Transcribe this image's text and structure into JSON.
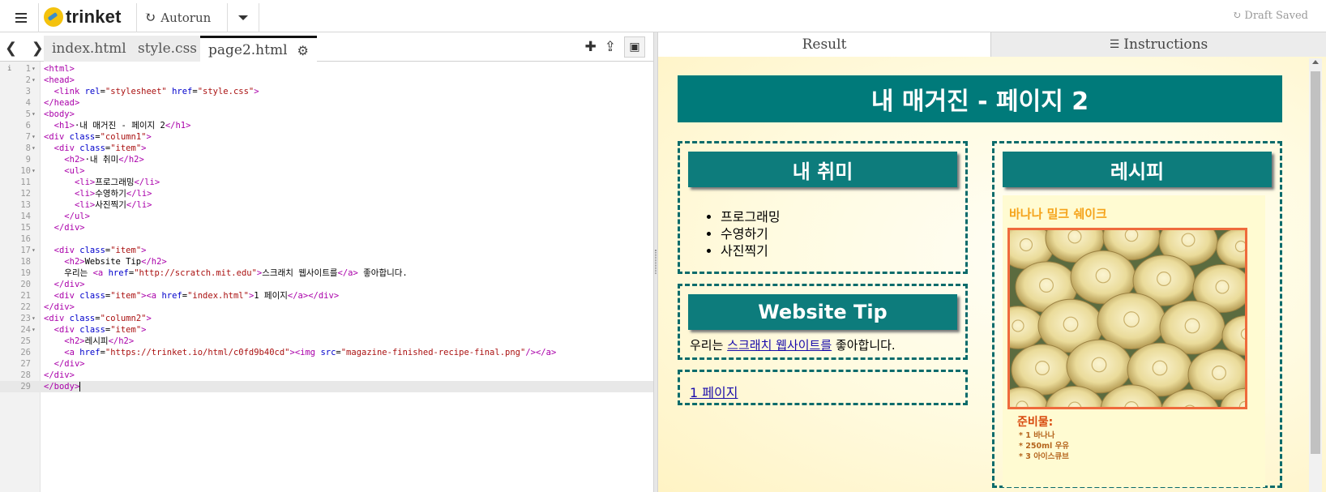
{
  "topbar": {
    "logo_text": "trinket",
    "autorun_label": "Autorun",
    "draft_status": "Draft Saved"
  },
  "editor": {
    "nav_arrows": "❮ ❯",
    "tabs": [
      {
        "label": "index.html"
      },
      {
        "label": "style.css"
      },
      {
        "label": "page2.html"
      }
    ],
    "active_tab": "page2.html"
  },
  "code_lines": [
    {
      "n": "1",
      "text": "<html>"
    },
    {
      "n": "2",
      "text": "<head>"
    },
    {
      "n": "3",
      "text": "  <link rel=\"stylesheet\" href=\"style.css\">"
    },
    {
      "n": "4",
      "text": "</head>"
    },
    {
      "n": "5",
      "text": "<body>"
    },
    {
      "n": "6",
      "text": "  <h1>·내 매거진 - 페이지 2</h1>"
    },
    {
      "n": "7",
      "text": "<div class=\"column1\">"
    },
    {
      "n": "8",
      "text": "  <div class=\"item\">"
    },
    {
      "n": "9",
      "text": "    <h2>·내 취미</h2>"
    },
    {
      "n": "10",
      "text": "    <ul>"
    },
    {
      "n": "11",
      "text": "      <li>프로그래밍</li>"
    },
    {
      "n": "12",
      "text": "      <li>수영하기</li>"
    },
    {
      "n": "13",
      "text": "      <li>사진찍기</li>"
    },
    {
      "n": "14",
      "text": "    </ul>"
    },
    {
      "n": "15",
      "text": "  </div>"
    },
    {
      "n": "16",
      "text": ""
    },
    {
      "n": "17",
      "text": "  <div class=\"item\">"
    },
    {
      "n": "18",
      "text": "    <h2>Website Tip</h2>"
    },
    {
      "n": "19",
      "text": "    우리는 <a href=\"http://scratch.mit.edu\">스크래치 웹사이트를</a> 좋아합니다."
    },
    {
      "n": "20",
      "text": "  </div>"
    },
    {
      "n": "21",
      "text": "  <div class=\"item\"><a href=\"index.html\">1 페이지</a></div>"
    },
    {
      "n": "22",
      "text": "</div>"
    },
    {
      "n": "23",
      "text": "<div class=\"column2\">"
    },
    {
      "n": "24",
      "text": "  <div class=\"item\">"
    },
    {
      "n": "25",
      "text": "    <h2>레시피</h2>"
    },
    {
      "n": "26",
      "text": "    <a href=\"https://trinket.io/html/c0fd9b40cd\"><img src=\"magazine-finished-recipe-final.png\"/></a>"
    },
    {
      "n": "27",
      "text": "  </div>"
    },
    {
      "n": "28",
      "text": "</div>"
    },
    {
      "n": "29",
      "text": "</body>"
    }
  ],
  "result_tabs": {
    "result_label": "Result",
    "instructions_label": "Instructions"
  },
  "preview": {
    "title": "내 매거진 - 페이지 2",
    "hobbies": {
      "heading": "내 취미",
      "items": [
        "프로그래밍",
        "수영하기",
        "사진찍기"
      ]
    },
    "tip": {
      "heading": "Website Tip",
      "text_before": "우리는 ",
      "link_text": "스크래치 웹사이트를",
      "text_after": " 좋아합니다."
    },
    "page_link": "1 페이지",
    "recipe": {
      "heading": "레시피",
      "title": "바나나 밀크 쉐이크",
      "ingredients_heading": "준비물:",
      "ingredients": [
        "* 1 바나나",
        "* 250ml 우유",
        "* 3 아이스큐브"
      ]
    }
  },
  "colors": {
    "teal": "#007a7a",
    "recipe_title": "#f5a31a",
    "ingredients": "#d84a0e"
  }
}
